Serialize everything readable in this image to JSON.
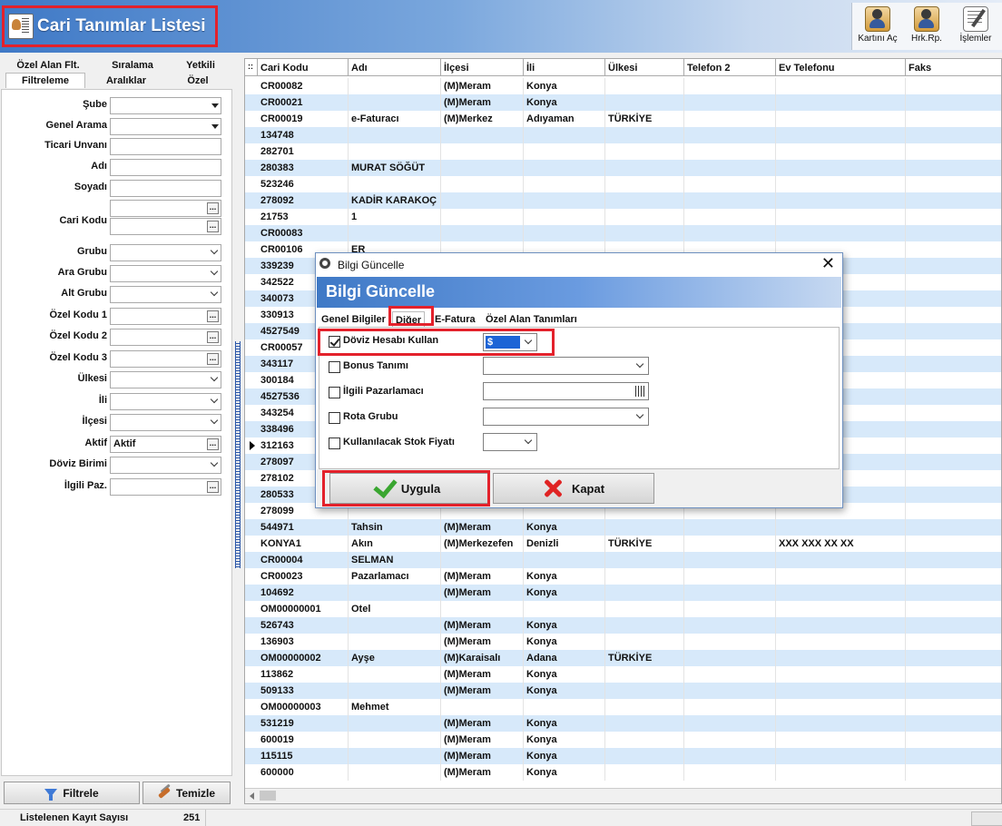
{
  "header": {
    "title": "Cari Tanımlar Listesi",
    "toolbar": [
      {
        "label": "Kartını Aç",
        "icon": "card-icon"
      },
      {
        "label": "Hrk.Rp.",
        "icon": "card-icon"
      },
      {
        "label": "İşlemler",
        "icon": "process-icon"
      }
    ]
  },
  "left": {
    "tabs_top": [
      "Özel Alan Flt.",
      "Sıralama",
      "Yetkili"
    ],
    "tabs_bottom": [
      "Filtreleme",
      "Aralıklar",
      "Özel"
    ],
    "filters": [
      {
        "label": "Şube",
        "type": "dropdown",
        "value": ""
      },
      {
        "label": "Genel Arama",
        "type": "dropdown",
        "value": ""
      },
      {
        "label": "Ticari Unvanı",
        "type": "text",
        "value": ""
      },
      {
        "label": "Adı",
        "type": "text",
        "value": ""
      },
      {
        "label": "Soyadı",
        "type": "text",
        "value": ""
      },
      {
        "label": "Cari Kodu",
        "type": "ellipsis2",
        "value": ""
      },
      {
        "label": "Grubu",
        "type": "combo",
        "value": ""
      },
      {
        "label": "Ara Grubu",
        "type": "combo",
        "value": ""
      },
      {
        "label": "Alt Grubu",
        "type": "combo",
        "value": ""
      },
      {
        "label": "Özel Kodu 1",
        "type": "ellipsis",
        "value": ""
      },
      {
        "label": "Özel Kodu 2",
        "type": "ellipsis",
        "value": ""
      },
      {
        "label": "Özel Kodu 3",
        "type": "ellipsis",
        "value": ""
      },
      {
        "label": "Ülkesi",
        "type": "combo",
        "value": ""
      },
      {
        "label": "İli",
        "type": "combo",
        "value": ""
      },
      {
        "label": "İlçesi",
        "type": "combo",
        "value": ""
      },
      {
        "label": "Aktif",
        "type": "ellipsis",
        "value": "Aktif"
      },
      {
        "label": "Döviz Birimi",
        "type": "combo",
        "value": ""
      },
      {
        "label": "İlgili Paz.",
        "type": "ellipsis",
        "value": ""
      }
    ],
    "filter_button": "Filtrele",
    "clear_button": "Temizle"
  },
  "status": {
    "label": "Listelenen Kayıt Sayısı",
    "count": "251"
  },
  "grid": {
    "columns": [
      "Cari Kodu",
      "Adı",
      "İlçesi",
      "İli",
      "Ülkesi",
      "Telefon 2",
      "Ev Telefonu",
      "Faks"
    ],
    "rows": [
      [
        "CR00082",
        "",
        "(M)Meram",
        "Konya",
        "",
        "",
        "",
        ""
      ],
      [
        "CR00021",
        "",
        "(M)Meram",
        "Konya",
        "",
        "",
        "",
        ""
      ],
      [
        "CR00019",
        "e-Faturacı",
        "(M)Merkez",
        "Adıyaman",
        "TÜRKİYE",
        "",
        "",
        ""
      ],
      [
        "134748",
        "",
        "",
        "",
        "",
        "",
        "",
        ""
      ],
      [
        "282701",
        "",
        "",
        "",
        "",
        "",
        "",
        ""
      ],
      [
        "280383",
        "MURAT SÖĞÜT",
        "",
        "",
        "",
        "",
        "",
        ""
      ],
      [
        "523246",
        "",
        "",
        "",
        "",
        "",
        "",
        ""
      ],
      [
        "278092",
        "KADİR KARAKOÇ",
        "",
        "",
        "",
        "",
        "",
        ""
      ],
      [
        "21753",
        "1",
        "",
        "",
        "",
        "",
        "",
        ""
      ],
      [
        "CR00083",
        "",
        "",
        "",
        "",
        "",
        "",
        ""
      ],
      [
        "CR00106",
        "ER",
        "",
        "",
        "",
        "",
        "",
        ""
      ],
      [
        "339239",
        "",
        "",
        "",
        "",
        "",
        "",
        ""
      ],
      [
        "342522",
        "",
        "",
        "",
        "",
        "",
        "",
        ""
      ],
      [
        "340073",
        "",
        "",
        "",
        "",
        "",
        "",
        ""
      ],
      [
        "330913",
        "",
        "",
        "",
        "",
        "",
        "",
        ""
      ],
      [
        "4527549",
        "",
        "",
        "",
        "",
        "",
        "",
        ""
      ],
      [
        "CR00057",
        "",
        "",
        "",
        "",
        "",
        "",
        ""
      ],
      [
        "343117",
        "",
        "",
        "",
        "",
        "",
        "",
        ""
      ],
      [
        "300184",
        "",
        "",
        "",
        "",
        "",
        "",
        ""
      ],
      [
        "4527536",
        "",
        "",
        "",
        "",
        "",
        "",
        ""
      ],
      [
        "343254",
        "",
        "",
        "",
        "",
        "",
        "",
        ""
      ],
      [
        "338496",
        "",
        "",
        "",
        "",
        "",
        "",
        ""
      ],
      [
        "312163",
        "",
        "",
        "",
        "",
        "",
        "",
        ""
      ],
      [
        "278097",
        "",
        "",
        "",
        "",
        "",
        "",
        ""
      ],
      [
        "278102",
        "",
        "",
        "",
        "",
        "",
        "",
        ""
      ],
      [
        "280533",
        "",
        "",
        "",
        "",
        "",
        "",
        ""
      ],
      [
        "278099",
        "",
        "",
        "",
        "",
        "",
        "",
        ""
      ],
      [
        "544971",
        "Tahsin",
        "(M)Meram",
        "Konya",
        "",
        "",
        "",
        ""
      ],
      [
        "KONYA1",
        "Akın",
        "(M)Merkezefen",
        "Denizli",
        "TÜRKİYE",
        "",
        "XXX XXX XX XX",
        ""
      ],
      [
        "CR00004",
        "SELMAN",
        "",
        "",
        "",
        "",
        "",
        ""
      ],
      [
        "CR00023",
        "Pazarlamacı",
        "(M)Meram",
        "Konya",
        "",
        "",
        "",
        ""
      ],
      [
        "104692",
        "",
        "(M)Meram",
        "Konya",
        "",
        "",
        "",
        ""
      ],
      [
        "OM00000001",
        "Otel",
        "",
        "",
        "",
        "",
        "",
        ""
      ],
      [
        "526743",
        "",
        "(M)Meram",
        "Konya",
        "",
        "",
        "",
        ""
      ],
      [
        "136903",
        "",
        "(M)Meram",
        "Konya",
        "",
        "",
        "",
        ""
      ],
      [
        "OM00000002",
        "Ayşe",
        "(M)Karaisalı",
        "Adana",
        "TÜRKİYE",
        "",
        "",
        ""
      ],
      [
        "113862",
        "",
        "(M)Meram",
        "Konya",
        "",
        "",
        "",
        ""
      ],
      [
        "509133",
        "",
        "(M)Meram",
        "Konya",
        "",
        "",
        "",
        ""
      ],
      [
        "OM00000003",
        "Mehmet",
        "",
        "",
        "",
        "",
        "",
        ""
      ],
      [
        "531219",
        "",
        "(M)Meram",
        "Konya",
        "",
        "",
        "",
        ""
      ],
      [
        "600019",
        "",
        "(M)Meram",
        "Konya",
        "",
        "",
        "",
        ""
      ],
      [
        "115115",
        "",
        "(M)Meram",
        "Konya",
        "",
        "",
        "",
        ""
      ],
      [
        "600000",
        "",
        "(M)Meram",
        "Konya",
        "",
        "",
        "",
        ""
      ]
    ],
    "current_row": 22
  },
  "dialog": {
    "window_title": "Bilgi Güncelle",
    "banner": "Bilgi Güncelle",
    "tabs": [
      "Genel Bilgiler",
      "Diğer",
      "E-Fatura",
      "Özel Alan Tanımları"
    ],
    "active_tab": 1,
    "options": [
      {
        "label": "Döviz Hesabı Kullan",
        "checked": true,
        "value": "$"
      },
      {
        "label": "Bonus Tanımı",
        "checked": false,
        "value": ""
      },
      {
        "label": "İlgili Pazarlamacı",
        "checked": false,
        "value": ""
      },
      {
        "label": "Rota Grubu",
        "checked": false,
        "value": ""
      },
      {
        "label": "Kullanılacak Stok Fiyatı",
        "checked": false,
        "value": ""
      }
    ],
    "apply_button": "Uygula",
    "close_button": "Kapat"
  }
}
